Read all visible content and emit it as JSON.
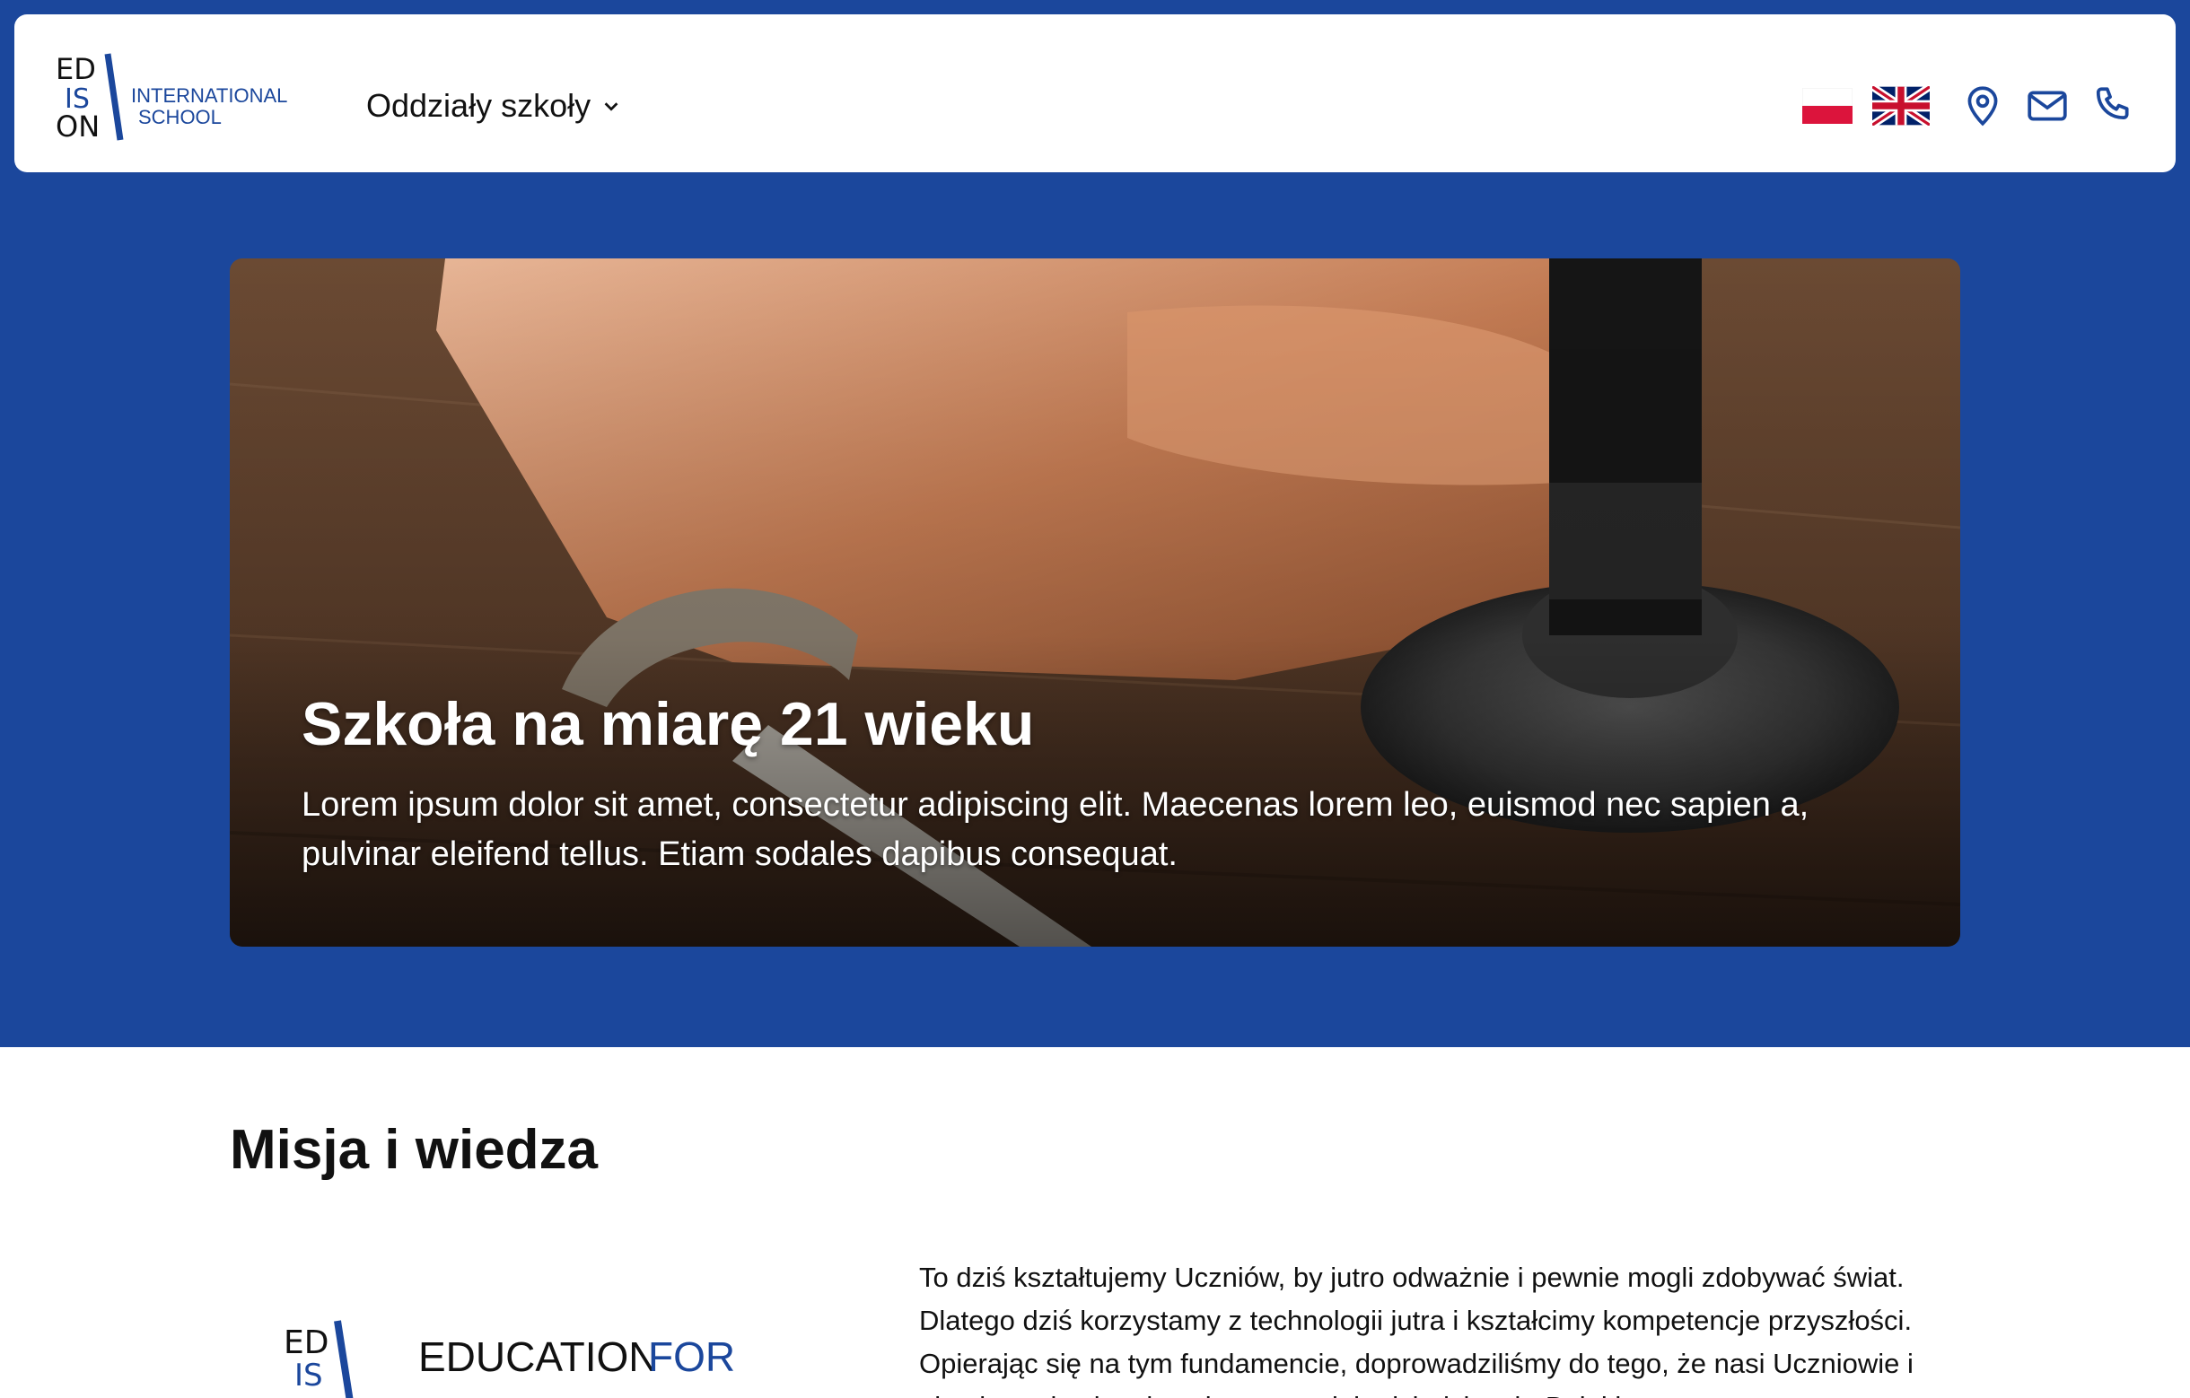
{
  "colors": {
    "brand_blue": "#1b479c",
    "white": "#ffffff",
    "text": "#111111"
  },
  "header": {
    "logo": {
      "letters": [
        "ED",
        "IS",
        "ON"
      ],
      "line1": "INTERNATIONAL",
      "line2": "SCHOOL"
    },
    "branches_label": "Oddziały szkoły",
    "icons": [
      "flag-pl-icon",
      "flag-uk-icon",
      "location-pin-icon",
      "mail-icon",
      "phone-icon"
    ]
  },
  "hero": {
    "title": "Szkoła na miarę 21 wieku",
    "text": "Lorem ipsum dolor sit amet, consectetur adipiscing elit. Maecenas lorem leo, euismod nec sapien a, pulvinar eleifend tellus. Etiam sodales dapibus consequat."
  },
  "mission": {
    "title": "Misja i wiedza",
    "logo_text_a": "EDUCATION",
    "logo_text_b": "FOR",
    "text": "To dziś kształtujemy Uczniów, by jutro odważnie i pewnie mogli zdobywać świat. Dlatego dziś korzystamy z technologii jutra i kształcimy kompetencje przyszłości. Opierając się na tym fundamencie, doprowadziliśmy do tego, że nasi Uczniowie i absolwenci osiągają sukcesy w wielu dziedzinach. Dzięki"
  }
}
